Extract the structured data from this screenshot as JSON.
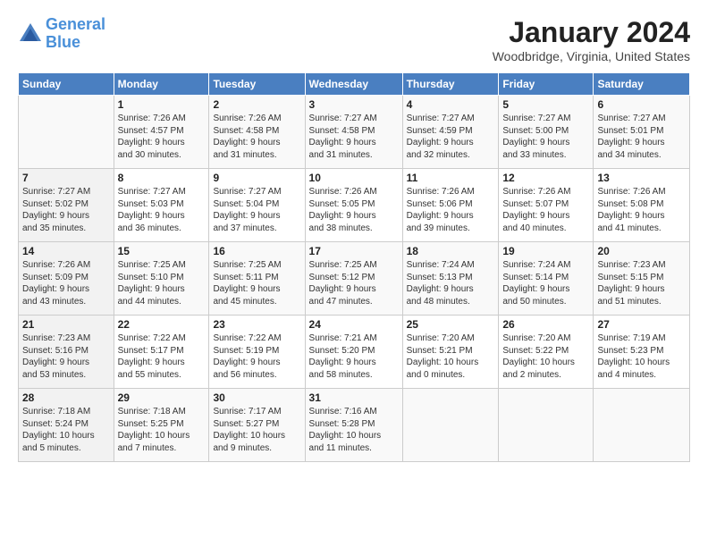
{
  "header": {
    "logo_line1": "General",
    "logo_line2": "Blue",
    "month_title": "January 2024",
    "location": "Woodbridge, Virginia, United States"
  },
  "days_of_week": [
    "Sunday",
    "Monday",
    "Tuesday",
    "Wednesday",
    "Thursday",
    "Friday",
    "Saturday"
  ],
  "weeks": [
    [
      {
        "day": "",
        "info": ""
      },
      {
        "day": "1",
        "info": "Sunrise: 7:26 AM\nSunset: 4:57 PM\nDaylight: 9 hours\nand 30 minutes."
      },
      {
        "day": "2",
        "info": "Sunrise: 7:26 AM\nSunset: 4:58 PM\nDaylight: 9 hours\nand 31 minutes."
      },
      {
        "day": "3",
        "info": "Sunrise: 7:27 AM\nSunset: 4:58 PM\nDaylight: 9 hours\nand 31 minutes."
      },
      {
        "day": "4",
        "info": "Sunrise: 7:27 AM\nSunset: 4:59 PM\nDaylight: 9 hours\nand 32 minutes."
      },
      {
        "day": "5",
        "info": "Sunrise: 7:27 AM\nSunset: 5:00 PM\nDaylight: 9 hours\nand 33 minutes."
      },
      {
        "day": "6",
        "info": "Sunrise: 7:27 AM\nSunset: 5:01 PM\nDaylight: 9 hours\nand 34 minutes."
      }
    ],
    [
      {
        "day": "7",
        "info": "Sunrise: 7:27 AM\nSunset: 5:02 PM\nDaylight: 9 hours\nand 35 minutes."
      },
      {
        "day": "8",
        "info": "Sunrise: 7:27 AM\nSunset: 5:03 PM\nDaylight: 9 hours\nand 36 minutes."
      },
      {
        "day": "9",
        "info": "Sunrise: 7:27 AM\nSunset: 5:04 PM\nDaylight: 9 hours\nand 37 minutes."
      },
      {
        "day": "10",
        "info": "Sunrise: 7:26 AM\nSunset: 5:05 PM\nDaylight: 9 hours\nand 38 minutes."
      },
      {
        "day": "11",
        "info": "Sunrise: 7:26 AM\nSunset: 5:06 PM\nDaylight: 9 hours\nand 39 minutes."
      },
      {
        "day": "12",
        "info": "Sunrise: 7:26 AM\nSunset: 5:07 PM\nDaylight: 9 hours\nand 40 minutes."
      },
      {
        "day": "13",
        "info": "Sunrise: 7:26 AM\nSunset: 5:08 PM\nDaylight: 9 hours\nand 41 minutes."
      }
    ],
    [
      {
        "day": "14",
        "info": "Sunrise: 7:26 AM\nSunset: 5:09 PM\nDaylight: 9 hours\nand 43 minutes."
      },
      {
        "day": "15",
        "info": "Sunrise: 7:25 AM\nSunset: 5:10 PM\nDaylight: 9 hours\nand 44 minutes."
      },
      {
        "day": "16",
        "info": "Sunrise: 7:25 AM\nSunset: 5:11 PM\nDaylight: 9 hours\nand 45 minutes."
      },
      {
        "day": "17",
        "info": "Sunrise: 7:25 AM\nSunset: 5:12 PM\nDaylight: 9 hours\nand 47 minutes."
      },
      {
        "day": "18",
        "info": "Sunrise: 7:24 AM\nSunset: 5:13 PM\nDaylight: 9 hours\nand 48 minutes."
      },
      {
        "day": "19",
        "info": "Sunrise: 7:24 AM\nSunset: 5:14 PM\nDaylight: 9 hours\nand 50 minutes."
      },
      {
        "day": "20",
        "info": "Sunrise: 7:23 AM\nSunset: 5:15 PM\nDaylight: 9 hours\nand 51 minutes."
      }
    ],
    [
      {
        "day": "21",
        "info": "Sunrise: 7:23 AM\nSunset: 5:16 PM\nDaylight: 9 hours\nand 53 minutes."
      },
      {
        "day": "22",
        "info": "Sunrise: 7:22 AM\nSunset: 5:17 PM\nDaylight: 9 hours\nand 55 minutes."
      },
      {
        "day": "23",
        "info": "Sunrise: 7:22 AM\nSunset: 5:19 PM\nDaylight: 9 hours\nand 56 minutes."
      },
      {
        "day": "24",
        "info": "Sunrise: 7:21 AM\nSunset: 5:20 PM\nDaylight: 9 hours\nand 58 minutes."
      },
      {
        "day": "25",
        "info": "Sunrise: 7:20 AM\nSunset: 5:21 PM\nDaylight: 10 hours\nand 0 minutes."
      },
      {
        "day": "26",
        "info": "Sunrise: 7:20 AM\nSunset: 5:22 PM\nDaylight: 10 hours\nand 2 minutes."
      },
      {
        "day": "27",
        "info": "Sunrise: 7:19 AM\nSunset: 5:23 PM\nDaylight: 10 hours\nand 4 minutes."
      }
    ],
    [
      {
        "day": "28",
        "info": "Sunrise: 7:18 AM\nSunset: 5:24 PM\nDaylight: 10 hours\nand 5 minutes."
      },
      {
        "day": "29",
        "info": "Sunrise: 7:18 AM\nSunset: 5:25 PM\nDaylight: 10 hours\nand 7 minutes."
      },
      {
        "day": "30",
        "info": "Sunrise: 7:17 AM\nSunset: 5:27 PM\nDaylight: 10 hours\nand 9 minutes."
      },
      {
        "day": "31",
        "info": "Sunrise: 7:16 AM\nSunset: 5:28 PM\nDaylight: 10 hours\nand 11 minutes."
      },
      {
        "day": "",
        "info": ""
      },
      {
        "day": "",
        "info": ""
      },
      {
        "day": "",
        "info": ""
      }
    ]
  ]
}
